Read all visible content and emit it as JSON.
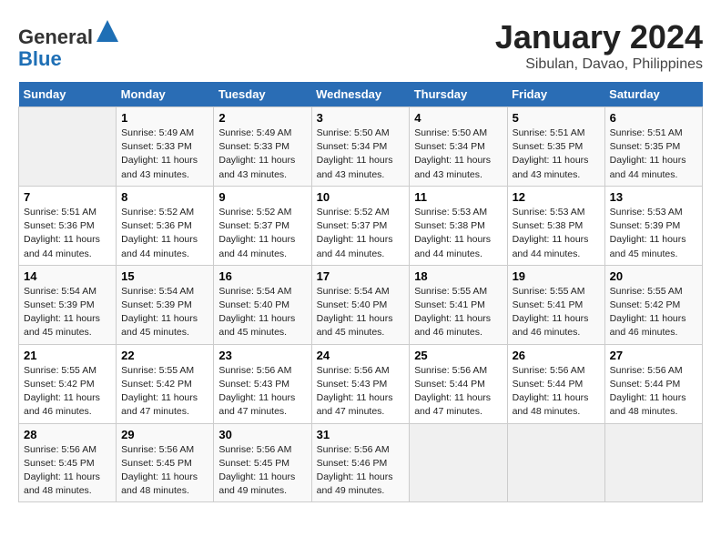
{
  "header": {
    "logo_line1": "General",
    "logo_line2": "Blue",
    "month": "January 2024",
    "location": "Sibulan, Davao, Philippines"
  },
  "weekdays": [
    "Sunday",
    "Monday",
    "Tuesday",
    "Wednesday",
    "Thursday",
    "Friday",
    "Saturday"
  ],
  "weeks": [
    [
      {
        "num": "",
        "info": ""
      },
      {
        "num": "1",
        "info": "Sunrise: 5:49 AM\nSunset: 5:33 PM\nDaylight: 11 hours\nand 43 minutes."
      },
      {
        "num": "2",
        "info": "Sunrise: 5:49 AM\nSunset: 5:33 PM\nDaylight: 11 hours\nand 43 minutes."
      },
      {
        "num": "3",
        "info": "Sunrise: 5:50 AM\nSunset: 5:34 PM\nDaylight: 11 hours\nand 43 minutes."
      },
      {
        "num": "4",
        "info": "Sunrise: 5:50 AM\nSunset: 5:34 PM\nDaylight: 11 hours\nand 43 minutes."
      },
      {
        "num": "5",
        "info": "Sunrise: 5:51 AM\nSunset: 5:35 PM\nDaylight: 11 hours\nand 43 minutes."
      },
      {
        "num": "6",
        "info": "Sunrise: 5:51 AM\nSunset: 5:35 PM\nDaylight: 11 hours\nand 44 minutes."
      }
    ],
    [
      {
        "num": "7",
        "info": "Sunrise: 5:51 AM\nSunset: 5:36 PM\nDaylight: 11 hours\nand 44 minutes."
      },
      {
        "num": "8",
        "info": "Sunrise: 5:52 AM\nSunset: 5:36 PM\nDaylight: 11 hours\nand 44 minutes."
      },
      {
        "num": "9",
        "info": "Sunrise: 5:52 AM\nSunset: 5:37 PM\nDaylight: 11 hours\nand 44 minutes."
      },
      {
        "num": "10",
        "info": "Sunrise: 5:52 AM\nSunset: 5:37 PM\nDaylight: 11 hours\nand 44 minutes."
      },
      {
        "num": "11",
        "info": "Sunrise: 5:53 AM\nSunset: 5:38 PM\nDaylight: 11 hours\nand 44 minutes."
      },
      {
        "num": "12",
        "info": "Sunrise: 5:53 AM\nSunset: 5:38 PM\nDaylight: 11 hours\nand 44 minutes."
      },
      {
        "num": "13",
        "info": "Sunrise: 5:53 AM\nSunset: 5:39 PM\nDaylight: 11 hours\nand 45 minutes."
      }
    ],
    [
      {
        "num": "14",
        "info": "Sunrise: 5:54 AM\nSunset: 5:39 PM\nDaylight: 11 hours\nand 45 minutes."
      },
      {
        "num": "15",
        "info": "Sunrise: 5:54 AM\nSunset: 5:39 PM\nDaylight: 11 hours\nand 45 minutes."
      },
      {
        "num": "16",
        "info": "Sunrise: 5:54 AM\nSunset: 5:40 PM\nDaylight: 11 hours\nand 45 minutes."
      },
      {
        "num": "17",
        "info": "Sunrise: 5:54 AM\nSunset: 5:40 PM\nDaylight: 11 hours\nand 45 minutes."
      },
      {
        "num": "18",
        "info": "Sunrise: 5:55 AM\nSunset: 5:41 PM\nDaylight: 11 hours\nand 46 minutes."
      },
      {
        "num": "19",
        "info": "Sunrise: 5:55 AM\nSunset: 5:41 PM\nDaylight: 11 hours\nand 46 minutes."
      },
      {
        "num": "20",
        "info": "Sunrise: 5:55 AM\nSunset: 5:42 PM\nDaylight: 11 hours\nand 46 minutes."
      }
    ],
    [
      {
        "num": "21",
        "info": "Sunrise: 5:55 AM\nSunset: 5:42 PM\nDaylight: 11 hours\nand 46 minutes."
      },
      {
        "num": "22",
        "info": "Sunrise: 5:55 AM\nSunset: 5:42 PM\nDaylight: 11 hours\nand 47 minutes."
      },
      {
        "num": "23",
        "info": "Sunrise: 5:56 AM\nSunset: 5:43 PM\nDaylight: 11 hours\nand 47 minutes."
      },
      {
        "num": "24",
        "info": "Sunrise: 5:56 AM\nSunset: 5:43 PM\nDaylight: 11 hours\nand 47 minutes."
      },
      {
        "num": "25",
        "info": "Sunrise: 5:56 AM\nSunset: 5:44 PM\nDaylight: 11 hours\nand 47 minutes."
      },
      {
        "num": "26",
        "info": "Sunrise: 5:56 AM\nSunset: 5:44 PM\nDaylight: 11 hours\nand 48 minutes."
      },
      {
        "num": "27",
        "info": "Sunrise: 5:56 AM\nSunset: 5:44 PM\nDaylight: 11 hours\nand 48 minutes."
      }
    ],
    [
      {
        "num": "28",
        "info": "Sunrise: 5:56 AM\nSunset: 5:45 PM\nDaylight: 11 hours\nand 48 minutes."
      },
      {
        "num": "29",
        "info": "Sunrise: 5:56 AM\nSunset: 5:45 PM\nDaylight: 11 hours\nand 48 minutes."
      },
      {
        "num": "30",
        "info": "Sunrise: 5:56 AM\nSunset: 5:45 PM\nDaylight: 11 hours\nand 49 minutes."
      },
      {
        "num": "31",
        "info": "Sunrise: 5:56 AM\nSunset: 5:46 PM\nDaylight: 11 hours\nand 49 minutes."
      },
      {
        "num": "",
        "info": ""
      },
      {
        "num": "",
        "info": ""
      },
      {
        "num": "",
        "info": ""
      }
    ]
  ]
}
